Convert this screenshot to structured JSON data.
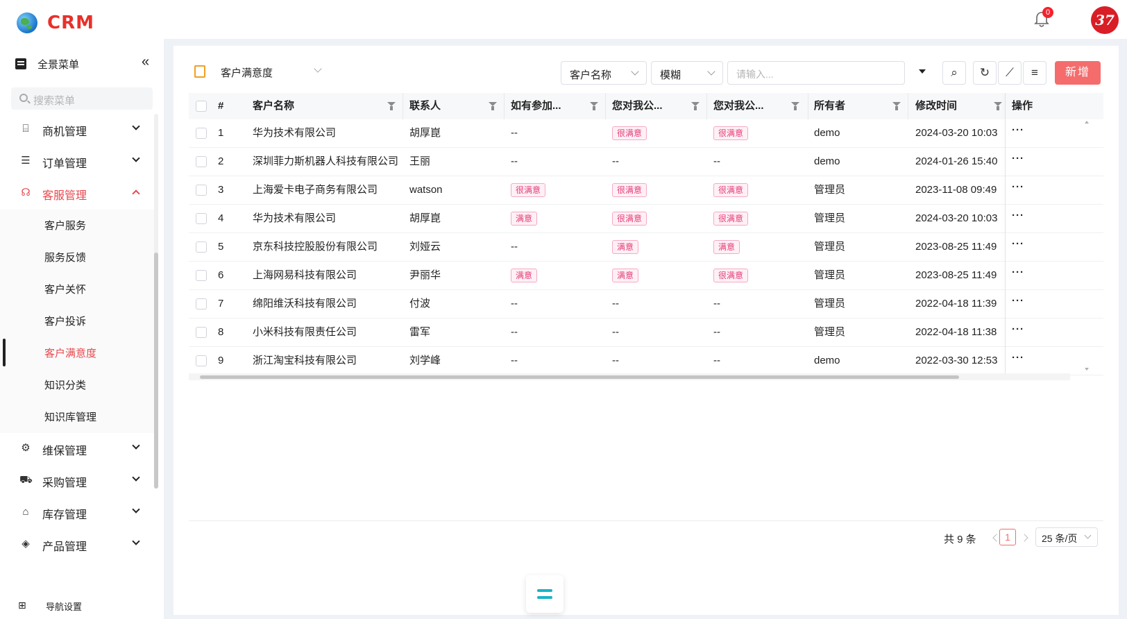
{
  "app": {
    "logo_text": "CRM",
    "notification_count": "0",
    "avatar_text": "37"
  },
  "sidebar": {
    "title": "全景菜单",
    "collapse_icon": "«",
    "search_placeholder": "搜索菜单",
    "items": [
      {
        "label": "商机管理",
        "icon": "briefcase-icon",
        "glyph": "⌸"
      },
      {
        "label": "订单管理",
        "icon": "document-icon",
        "glyph": "☰"
      },
      {
        "label": "客服管理",
        "icon": "headset-icon",
        "glyph": "☊"
      },
      {
        "label": "维保管理",
        "icon": "wrench-icon",
        "glyph": "⚙"
      },
      {
        "label": "采购管理",
        "icon": "cart-icon",
        "glyph": "⛟"
      },
      {
        "label": "库存管理",
        "icon": "warehouse-icon",
        "glyph": "⌂"
      },
      {
        "label": "产品管理",
        "icon": "box-icon",
        "glyph": "◈"
      }
    ],
    "submenu": [
      "客户服务",
      "服务反馈",
      "客户关怀",
      "客户投诉",
      "客户满意度",
      "知识分类",
      "知识库管理"
    ],
    "active_submenu": "客户满意度",
    "footer_label": "导航设置",
    "footer_glyph": "⊞"
  },
  "toolbar": {
    "view_label": "客户满意度",
    "field_select": "客户名称",
    "match_select": "模糊",
    "input_placeholder": "请输入...",
    "search_glyph": "⌕",
    "refresh_glyph": "↻",
    "chart_glyph": "⟋",
    "menu_glyph": "≡",
    "new_label": "新增"
  },
  "table": {
    "columns": [
      "#",
      "客户名称",
      "联系人",
      "如有参加...",
      "您对我公...",
      "您对我公...",
      "所有者",
      "修改时间",
      "操作"
    ],
    "rows": [
      {
        "no": "1",
        "customer": "华为技术有限公司",
        "contact": "胡厚崑",
        "q1": "--",
        "q2": "很满意",
        "q3": "很满意",
        "owner": "demo",
        "time": "2024-03-20 10:03"
      },
      {
        "no": "2",
        "customer": "深圳菲力斯机器人科技有限公司",
        "contact": "王丽",
        "q1": "--",
        "q2": "--",
        "q3": "--",
        "owner": "demo",
        "time": "2024-01-26 15:40"
      },
      {
        "no": "3",
        "customer": "上海爱卡电子商务有限公司",
        "contact": "watson",
        "q1": "很满意",
        "q2": "很满意",
        "q3": "很满意",
        "owner": "管理员",
        "time": "2023-11-08 09:49"
      },
      {
        "no": "4",
        "customer": "华为技术有限公司",
        "contact": "胡厚崑",
        "q1": "满意",
        "q2": "很满意",
        "q3": "很满意",
        "owner": "管理员",
        "time": "2024-03-20 10:03"
      },
      {
        "no": "5",
        "customer": "京东科技控股股份有限公司",
        "contact": "刘娅云",
        "q1": "--",
        "q2": "满意",
        "q3": "满意",
        "owner": "管理员",
        "time": "2023-08-25 11:49"
      },
      {
        "no": "6",
        "customer": "上海网易科技有限公司",
        "contact": "尹丽华",
        "q1": "满意",
        "q2": "满意",
        "q3": "很满意",
        "owner": "管理员",
        "time": "2023-08-25 11:49"
      },
      {
        "no": "7",
        "customer": "绵阳维沃科技有限公司",
        "contact": "付波",
        "q1": "--",
        "q2": "--",
        "q3": "--",
        "owner": "管理员",
        "time": "2022-04-18 11:39"
      },
      {
        "no": "8",
        "customer": "小米科技有限责任公司",
        "contact": "雷军",
        "q1": "--",
        "q2": "--",
        "q3": "--",
        "owner": "管理员",
        "time": "2022-04-18 11:38"
      },
      {
        "no": "9",
        "customer": "浙江淘宝科技有限公司",
        "contact": "刘学峰",
        "q1": "--",
        "q2": "--",
        "q3": "--",
        "owner": "demo",
        "time": "2022-03-30 12:53"
      }
    ],
    "row_action": "···"
  },
  "pagination": {
    "total": "共 9 条",
    "current_page": "1",
    "page_size": "25 条/页"
  }
}
